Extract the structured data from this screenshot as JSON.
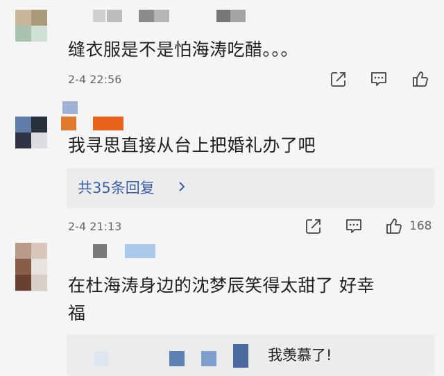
{
  "comments": [
    {
      "text": "缝衣服是不是怕海涛吃醋。。。",
      "timestamp": "2-4 22:56",
      "like_count": ""
    },
    {
      "text": "我寻思直接从台上把婚礼办了吧",
      "timestamp": "2-4 21:13",
      "like_count": "168",
      "replies_label": "共35条回复"
    },
    {
      "text_line1": "在杜海涛身边的沈梦辰笑得太甜了 好幸",
      "text_line2": "福",
      "sub_reply_text": "我羡慕了!"
    }
  ],
  "icons": {
    "share": "share-icon",
    "comment": "comment-icon",
    "like": "thumbs-up-icon",
    "chevron": "chevron-right-icon"
  },
  "colors": {
    "background": "#f5f5f5",
    "text": "#1f1f1f",
    "meta": "#666666",
    "link": "#3a5fa8",
    "reply_box": "#ececec"
  }
}
